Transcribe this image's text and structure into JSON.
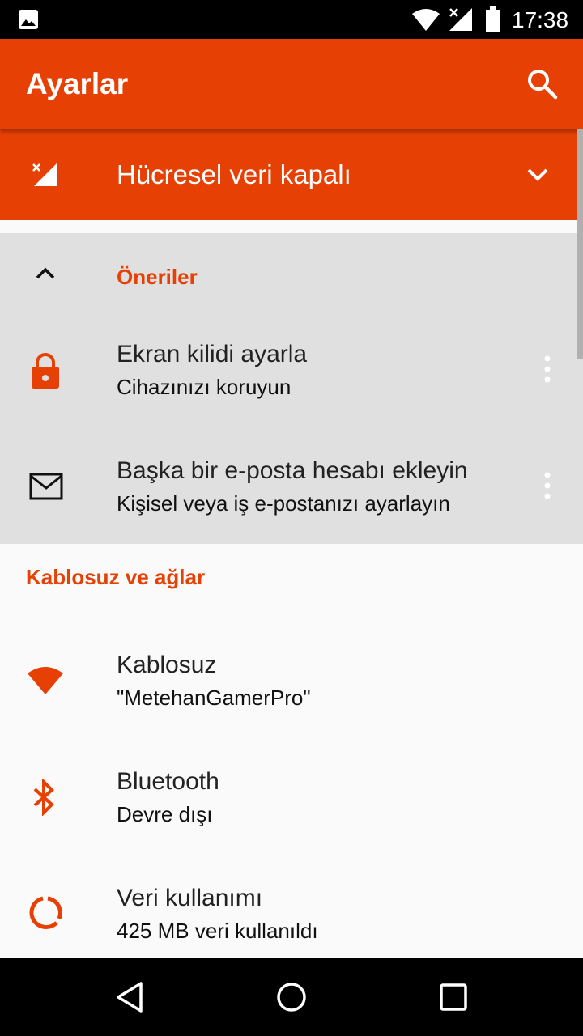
{
  "status_bar": {
    "time": "17:38",
    "icons": [
      "gallery-icon",
      "wifi-icon",
      "signal-no-data-icon",
      "battery-icon"
    ]
  },
  "app_bar": {
    "title": "Ayarlar",
    "search_icon": "search-icon"
  },
  "condition": {
    "label": "Hücresel veri kapalı",
    "icon": "signal-off-icon",
    "expand_icon": "chevron-down-icon"
  },
  "suggestions": {
    "header": "Öneriler",
    "collapse_icon": "chevron-up-icon",
    "items": [
      {
        "title": "Ekran kilidi ayarla",
        "subtitle": "Cihazınızı koruyun",
        "icon": "lock-icon",
        "more_icon": "more-vert-icon"
      },
      {
        "title": "Başka bir e-posta hesabı ekleyin",
        "subtitle": "Kişisel veya iş e-postanızı ayarlayın",
        "icon": "mail-icon",
        "more_icon": "more-vert-icon"
      }
    ]
  },
  "wireless": {
    "section_title": "Kablosuz ve ağlar",
    "items": [
      {
        "title": "Kablosuz",
        "subtitle": "\"MetehanGamerPro\"",
        "icon": "wifi-icon"
      },
      {
        "title": "Bluetooth",
        "subtitle": "Devre dışı",
        "icon": "bluetooth-icon"
      },
      {
        "title": "Veri kullanımı",
        "subtitle": "425 MB veri kullanıldı",
        "icon": "data-usage-icon"
      }
    ]
  },
  "colors": {
    "accent": "#e64004",
    "suggestion_bg": "#e0e0e0",
    "page_bg": "#fafafa"
  }
}
